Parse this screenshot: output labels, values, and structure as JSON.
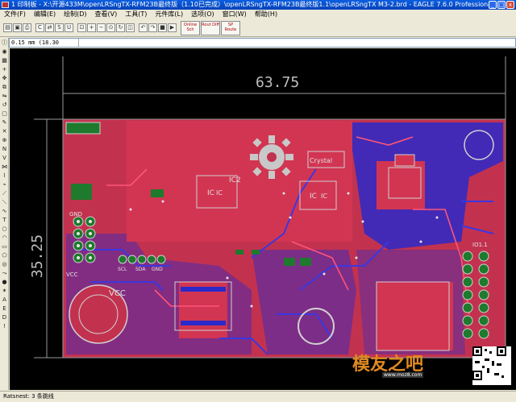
{
  "window": {
    "title": "1 印制板 - X:\\开源433M\\openLRSngTX-RFM23B最终版（1.10已完成）\\openLRSngTX-RFM23B最终版1.1\\openLRSngTX M3-2.brd - EAGLE 7.6.0 Professional",
    "min_label": "_",
    "max_label": "□",
    "close_label": "x"
  },
  "menu": {
    "items": [
      "文件(F)",
      "编辑(E)",
      "绘制(D)",
      "查看(V)",
      "工具(T)",
      "元件库(L)",
      "选项(O)",
      "窗口(W)",
      "帮助(H)"
    ]
  },
  "toolbar": {
    "big_buttons": [
      "Online Sch",
      "Rout Diff",
      "SP Route"
    ]
  },
  "command_bar": {
    "coordinate": "0.15 mm (18.30 44.40)",
    "input_value": ""
  },
  "canvas": {
    "dimension_horizontal": "63.75",
    "dimension_vertical": "35.25",
    "silk_labels": [
      "IC2",
      "IC",
      "IC",
      "Crystal",
      "VCC",
      "VCC",
      "GND",
      "IO1.1",
      "SCL",
      "SDA",
      "GND"
    ],
    "ic_labels": [
      "IC",
      "IC"
    ],
    "colors": {
      "board_fill": "#d63050",
      "top_copper": "#d23552",
      "bottom_copper": "#2b2ac9",
      "silk": "#d0d0d0",
      "pad_green": "#1e7a2c",
      "dimension": "#9a9a9a",
      "background": "#000000"
    }
  },
  "status": {
    "text": "Ratsnest: 3 条跳线"
  },
  "watermark": {
    "brand": "模友之吧",
    "url": "www.moz8.com"
  }
}
